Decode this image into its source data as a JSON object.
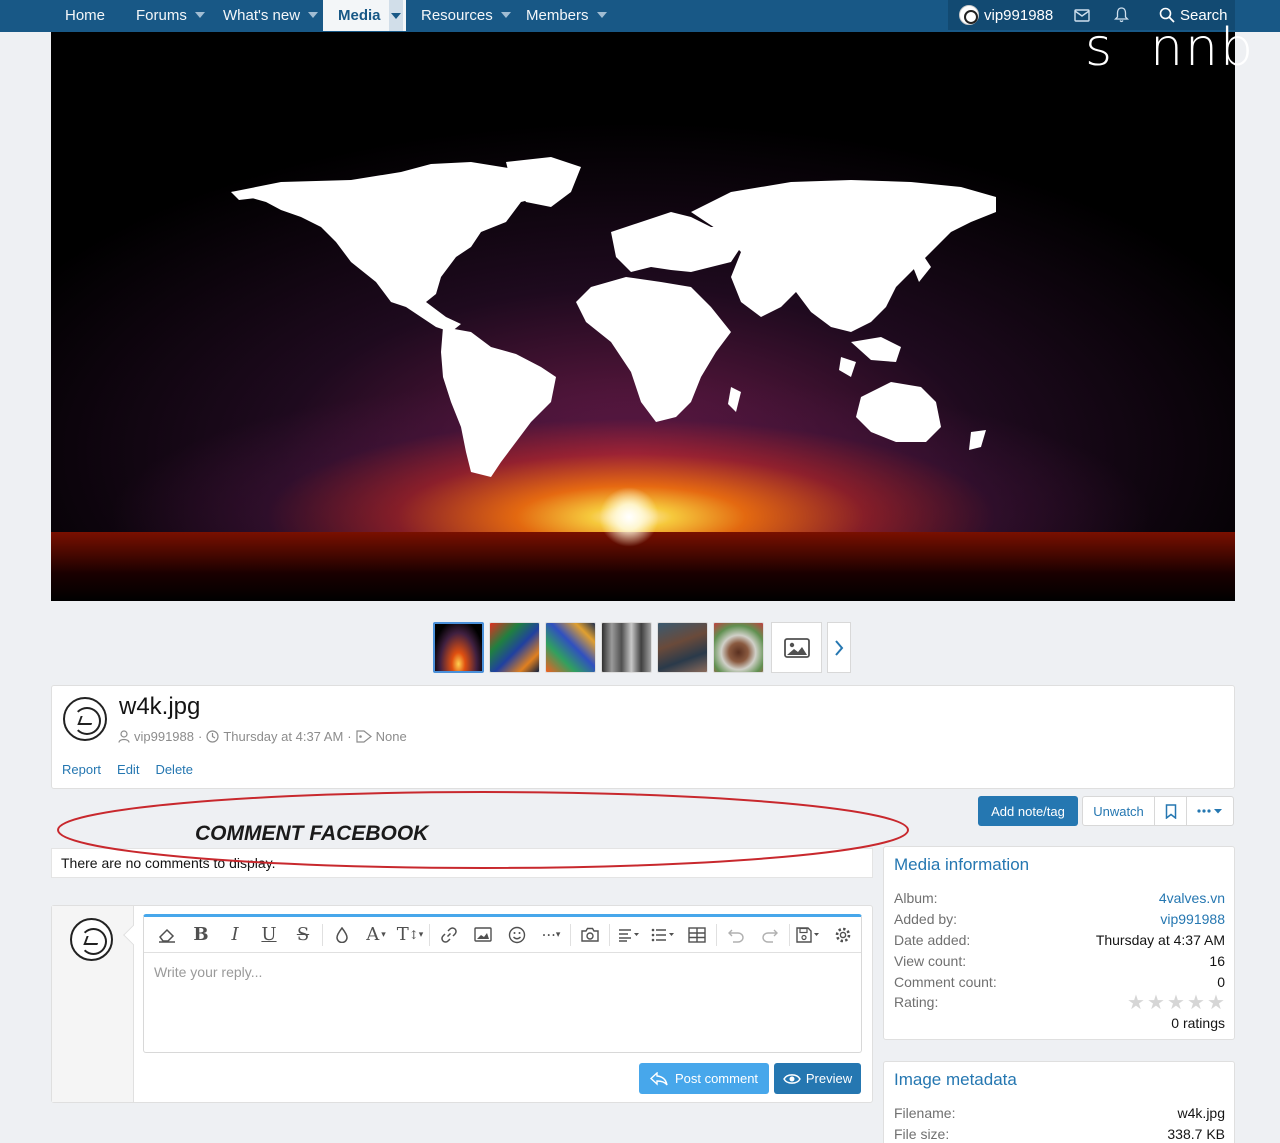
{
  "nav": {
    "items": [
      {
        "label": "Home",
        "caret": false
      },
      {
        "label": "Forums",
        "caret": true
      },
      {
        "label": "What's new",
        "caret": true
      },
      {
        "label": "Media",
        "caret": true,
        "active": true
      },
      {
        "label": "Resources",
        "caret": true
      },
      {
        "label": "Members",
        "caret": true
      }
    ],
    "username": "vip991988",
    "search_label": "Search"
  },
  "watermark": {
    "left": "s",
    "right": "nnb"
  },
  "media": {
    "title": "w4k.jpg",
    "author": "vip991988",
    "date": "Thursday at 4:37 AM",
    "tags": "None",
    "actions": {
      "report": "Report",
      "edit": "Edit",
      "delete": "Delete"
    },
    "add_note_label": "Add note/tag",
    "unwatch_label": "Unwatch"
  },
  "annotation": {
    "label": "COMMENT FACEBOOK"
  },
  "comments": {
    "empty_text": "There are no comments to display.",
    "placeholder": "Write your reply...",
    "post_label": "Post comment",
    "preview_label": "Preview"
  },
  "media_info": {
    "title": "Media information",
    "album_key": "Album:",
    "album": "4valves.vn",
    "added_by_key": "Added by:",
    "added_by": "vip991988",
    "date_key": "Date added:",
    "date": "Thursday at 4:37 AM",
    "views_key": "View count:",
    "views": "16",
    "comments_key": "Comment count:",
    "comments": "0",
    "rating_key": "Rating:",
    "rating_value": 0,
    "ratings_text": "0 ratings"
  },
  "image_meta": {
    "title": "Image metadata",
    "filename_key": "Filename:",
    "filename": "w4k.jpg",
    "filesize_key": "File size:",
    "filesize": "338.7 KB"
  },
  "colors": {
    "nav_bg": "#185886",
    "link": "#2577b1",
    "accent_button": "#2577b1",
    "annotation": "#c8282d"
  }
}
